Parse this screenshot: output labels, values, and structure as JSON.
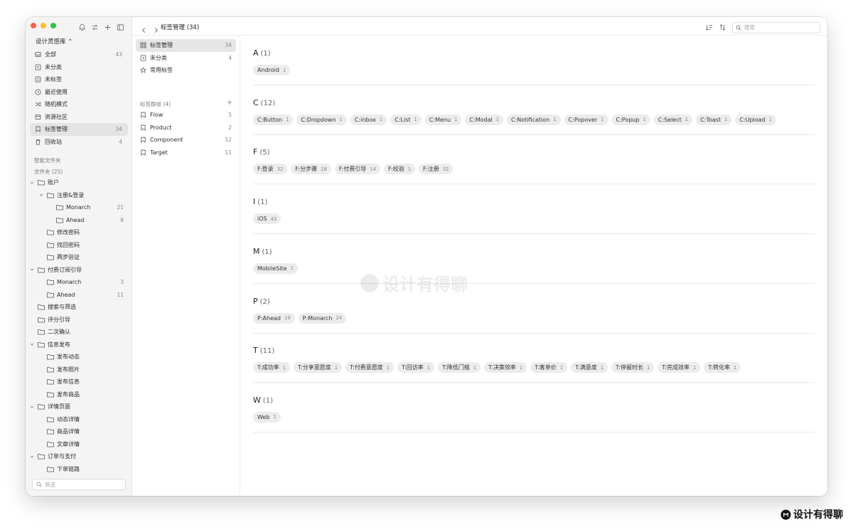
{
  "sidebar": {
    "library": "设计灵感库 ⌃",
    "nav": [
      {
        "label": "全部",
        "count": "43",
        "icon": "inbox-icon"
      },
      {
        "label": "未分类",
        "count": "",
        "icon": "unsorted-icon"
      },
      {
        "label": "未标签",
        "count": "",
        "icon": "untagged-icon"
      },
      {
        "label": "最近使用",
        "count": "",
        "icon": "clock-icon"
      },
      {
        "label": "随机模式",
        "count": "",
        "icon": "shuffle-icon"
      },
      {
        "label": "资源社区",
        "count": "",
        "icon": "community-icon"
      },
      {
        "label": "标签管理",
        "count": "34",
        "icon": "tag-icon"
      },
      {
        "label": "回收站",
        "count": "4",
        "icon": "trash-icon"
      }
    ],
    "smart_folders_label": "智能文件夹",
    "folders_label": "文件夹 (25)",
    "tree": [
      {
        "label": "账户",
        "level": 0,
        "count": "",
        "expanded": true
      },
      {
        "label": "注册&登录",
        "level": 1,
        "count": "",
        "expanded": true
      },
      {
        "label": "Monarch",
        "level": 2,
        "count": "21",
        "expanded": false
      },
      {
        "label": "Ahead",
        "level": 2,
        "count": "8",
        "expanded": false
      },
      {
        "label": "修改密码",
        "level": 1,
        "count": "",
        "expanded": false
      },
      {
        "label": "找回密码",
        "level": 1,
        "count": "",
        "expanded": false
      },
      {
        "label": "两步验证",
        "level": 1,
        "count": "",
        "expanded": false
      },
      {
        "label": "付费订阅引导",
        "level": 0,
        "count": "",
        "expanded": true
      },
      {
        "label": "Monarch",
        "level": 1,
        "count": "3",
        "expanded": false
      },
      {
        "label": "Ahead",
        "level": 1,
        "count": "11",
        "expanded": false
      },
      {
        "label": "搜索与筛选",
        "level": 0,
        "count": "",
        "expanded": false
      },
      {
        "label": "评分引导",
        "level": 0,
        "count": "",
        "expanded": false
      },
      {
        "label": "二次确认",
        "level": 0,
        "count": "",
        "expanded": false
      },
      {
        "label": "信息发布",
        "level": 0,
        "count": "",
        "expanded": true
      },
      {
        "label": "发布动态",
        "level": 1,
        "count": "",
        "expanded": false
      },
      {
        "label": "发布照片",
        "level": 1,
        "count": "",
        "expanded": false
      },
      {
        "label": "发布信息",
        "level": 1,
        "count": "",
        "expanded": false
      },
      {
        "label": "发布商品",
        "level": 1,
        "count": "",
        "expanded": false
      },
      {
        "label": "详情页面",
        "level": 0,
        "count": "",
        "expanded": true
      },
      {
        "label": "动态详情",
        "level": 1,
        "count": "",
        "expanded": false
      },
      {
        "label": "商品详情",
        "level": 1,
        "count": "",
        "expanded": false
      },
      {
        "label": "文章详情",
        "level": 1,
        "count": "",
        "expanded": false
      },
      {
        "label": "订单与支付",
        "level": 0,
        "count": "",
        "expanded": true
      },
      {
        "label": "下单链路",
        "level": 1,
        "count": "",
        "expanded": false
      }
    ],
    "filter_placeholder": "筛选"
  },
  "topbar": {
    "title": "标签管理 (34)",
    "search_placeholder": "搜索"
  },
  "mid": {
    "items": [
      {
        "label": "标签管理",
        "count": "34",
        "icon": "grid-icon",
        "active": true
      },
      {
        "label": "未分类",
        "count": "4",
        "icon": "unsorted-icon",
        "active": false
      },
      {
        "label": "常用标签",
        "count": "",
        "icon": "star-icon",
        "active": false
      }
    ],
    "group_label": "标签群组 (4)",
    "groups": [
      {
        "label": "Flow",
        "count": "5"
      },
      {
        "label": "Product",
        "count": "2"
      },
      {
        "label": "Component",
        "count": "12"
      },
      {
        "label": "Target",
        "count": "11"
      }
    ]
  },
  "sections": [
    {
      "letter": "A",
      "count": "(1)",
      "tags": [
        {
          "name": "Android",
          "count": "1"
        }
      ]
    },
    {
      "letter": "C",
      "count": "(12)",
      "tags": [
        {
          "name": "C:Button",
          "count": "1"
        },
        {
          "name": "C:Dropdown",
          "count": "1"
        },
        {
          "name": "C:inbox",
          "count": "1"
        },
        {
          "name": "C:List",
          "count": "1"
        },
        {
          "name": "C:Menu",
          "count": "1"
        },
        {
          "name": "C:Modal",
          "count": "1"
        },
        {
          "name": "C:Notification",
          "count": "1"
        },
        {
          "name": "C:Popover",
          "count": "1"
        },
        {
          "name": "C:Popup",
          "count": "1"
        },
        {
          "name": "C:Select",
          "count": "1"
        },
        {
          "name": "C:Toast",
          "count": "1"
        },
        {
          "name": "C:Upload",
          "count": "1"
        }
      ]
    },
    {
      "letter": "F",
      "count": "(5)",
      "tags": [
        {
          "name": "F:登录",
          "count": "32"
        },
        {
          "name": "F:分步骤",
          "count": "18"
        },
        {
          "name": "F:付费引导",
          "count": "14"
        },
        {
          "name": "F:校验",
          "count": "1"
        },
        {
          "name": "F:注册",
          "count": "32"
        }
      ]
    },
    {
      "letter": "I",
      "count": "(1)",
      "tags": [
        {
          "name": "iOS",
          "count": "43"
        }
      ]
    },
    {
      "letter": "M",
      "count": "(1)",
      "tags": [
        {
          "name": "MobileSite",
          "count": "1"
        }
      ]
    },
    {
      "letter": "P",
      "count": "(2)",
      "tags": [
        {
          "name": "P:Ahead",
          "count": "19"
        },
        {
          "name": "P:Monarch",
          "count": "24"
        }
      ]
    },
    {
      "letter": "T",
      "count": "(11)",
      "tags": [
        {
          "name": "T:成功率",
          "count": "1"
        },
        {
          "name": "T:分享意愿度",
          "count": "1"
        },
        {
          "name": "T:付费意愿度",
          "count": "1"
        },
        {
          "name": "T:回访率",
          "count": "1"
        },
        {
          "name": "T:降低门槛",
          "count": "1"
        },
        {
          "name": "T:决策效率",
          "count": "1"
        },
        {
          "name": "T:客单价",
          "count": "1"
        },
        {
          "name": "T:满意度",
          "count": "1"
        },
        {
          "name": "T:停留时长",
          "count": "1"
        },
        {
          "name": "T:完成效率",
          "count": "1"
        },
        {
          "name": "T:转化率",
          "count": "1"
        }
      ]
    },
    {
      "letter": "W",
      "count": "(1)",
      "tags": [
        {
          "name": "Web",
          "count": "1"
        }
      ]
    }
  ],
  "watermark": "设计有得聊",
  "corner_logo": "设计有得聊",
  "colors": {
    "active_bg": "#e4e4e4",
    "chip_bg": "#ececec",
    "traffic_red": "#fe5f57",
    "traffic_yellow": "#febc2e",
    "traffic_green": "#28c840"
  }
}
